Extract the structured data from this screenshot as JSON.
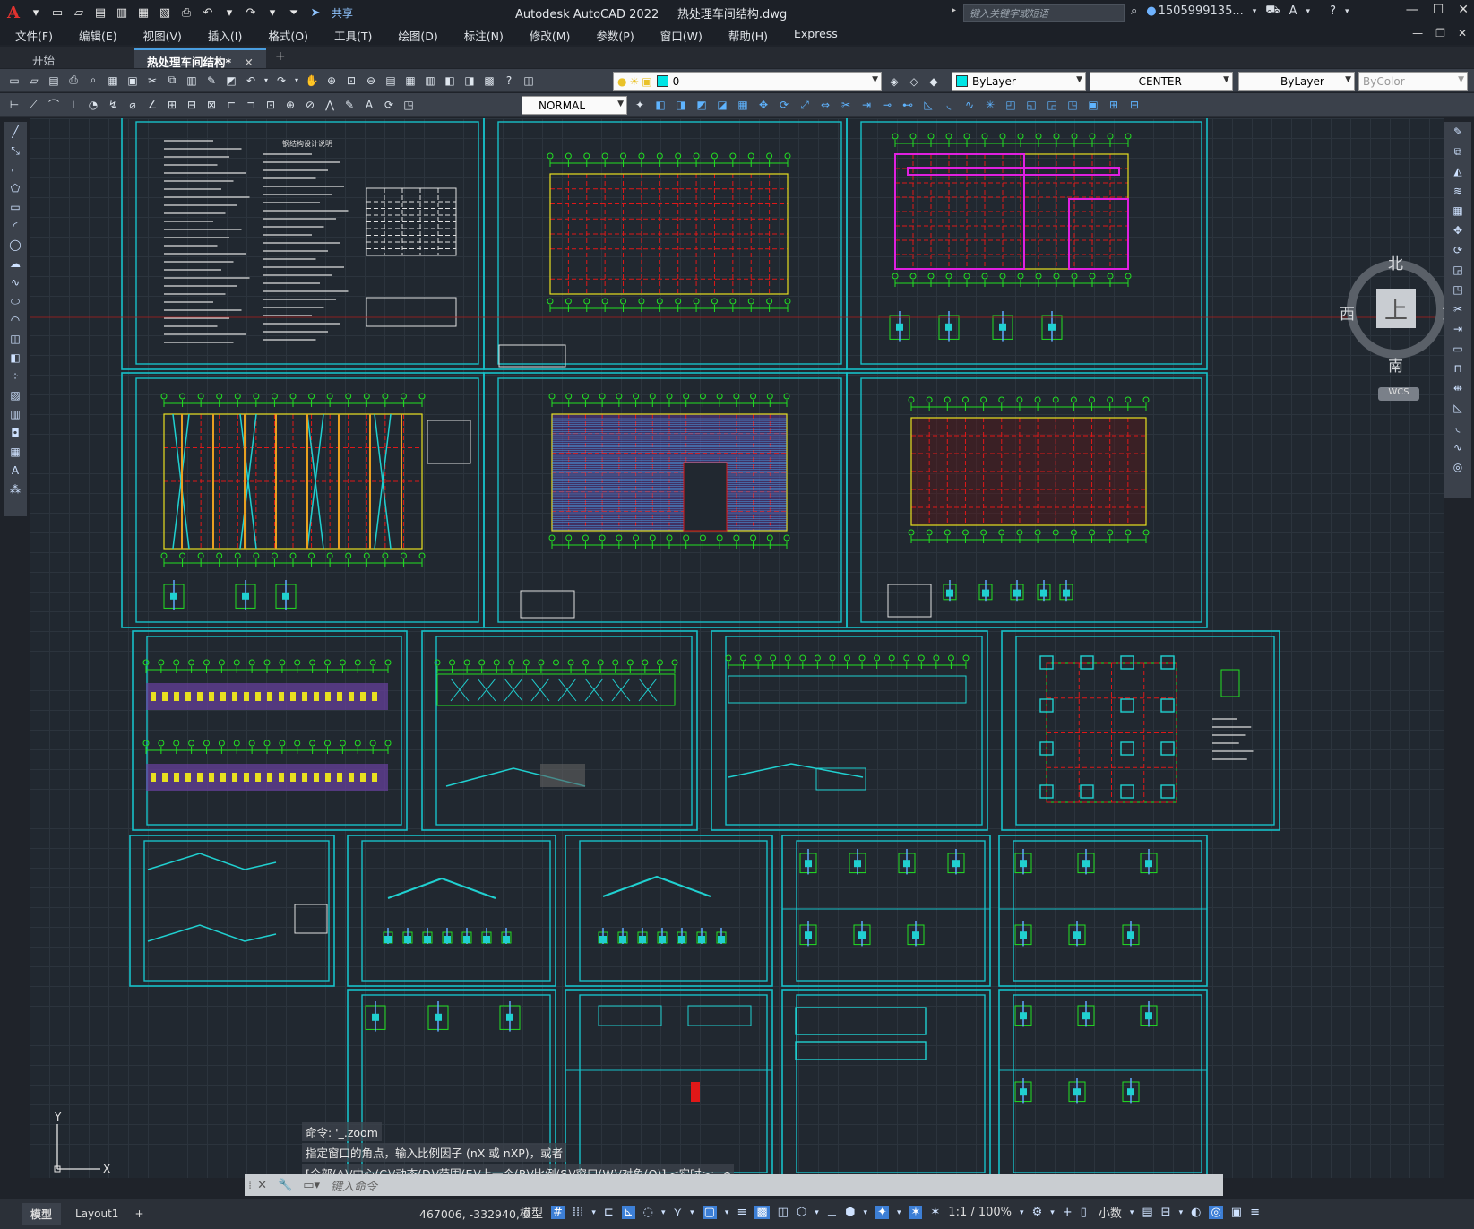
{
  "window": {
    "app_title": "Autodesk AutoCAD 2022",
    "file_name": "热处理车间结构.dwg",
    "share_label": "共享",
    "search_placeholder": "键入关键字或短语",
    "user": "1505999135...",
    "logo": "A"
  },
  "menu": [
    "文件(F)",
    "编辑(E)",
    "视图(V)",
    "插入(I)",
    "格式(O)",
    "工具(T)",
    "绘图(D)",
    "标注(N)",
    "修改(M)",
    "参数(P)",
    "窗口(W)",
    "帮助(H)",
    "Express"
  ],
  "tabs": [
    {
      "label": "开始"
    },
    {
      "label": "热处理车间结构*"
    }
  ],
  "toolbar": {
    "layer_value": "0",
    "color_value": "ByLayer",
    "linetype_value": "CENTER",
    "lineweight_value": "ByLayer",
    "plotstyle_value": "ByColor",
    "dimstyle_value": "NORMAL",
    "layer_color": "#00e5e5",
    "color_swatch": "#00e5e5"
  },
  "viewcube": {
    "north": "北",
    "south": "南",
    "east": "东",
    "west": "西",
    "face": "上",
    "wcs": "WCS"
  },
  "drawing": {
    "sheet1_title": "钢结构设计说明"
  },
  "ucs": {
    "x": "X",
    "y": "Y"
  },
  "command": {
    "history": [
      "命令: '_.zoom",
      "指定窗口的角点，输入比例因子 (nX 或 nXP)，或者",
      "[全部(A)/中心(C)/动态(D)/范围(E)/上一个(P)/比例(S)/窗口(W)/对象(O)] <实时>: _e"
    ],
    "placeholder": "键入命令"
  },
  "status": {
    "model_tab": "模型",
    "layout_tab": "Layout1",
    "coords": "467006, -332940, 0",
    "model_label": "模型",
    "scale": "1:1 / 100%",
    "units": "小数"
  },
  "colors": {
    "frame": "#17c0c8",
    "grid_red": "#e01818",
    "green": "#22e022",
    "magenta": "#e020e0",
    "yellow": "#e8e020"
  }
}
